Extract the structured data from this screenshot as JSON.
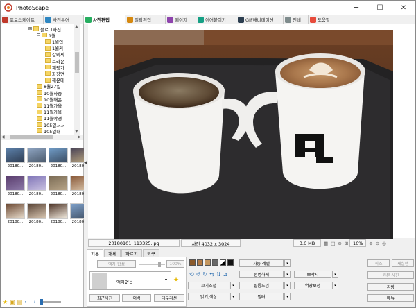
{
  "window": {
    "title": "PhotoScape",
    "minimize": "─",
    "maximize": "☐",
    "close": "✕"
  },
  "tabs": [
    {
      "label": "포토스케이프",
      "color": "#c0392b"
    },
    {
      "label": "사진뷰어",
      "color": "#2e86c1"
    },
    {
      "label": "사진편집",
      "color": "#27ae60"
    },
    {
      "label": "일괄편집",
      "color": "#d68910"
    },
    {
      "label": "페이지",
      "color": "#8e44ad"
    },
    {
      "label": "이어붙이기",
      "color": "#16a085"
    },
    {
      "label": "GIF애니메이션",
      "color": "#2c3e50"
    },
    {
      "label": "인쇄",
      "color": "#7f8c8d"
    },
    {
      "label": "도움말",
      "color": "#e74c3c"
    }
  ],
  "tree": {
    "items": [
      {
        "label": "블로그사진",
        "indent": 0,
        "expander": "⊟"
      },
      {
        "label": "1월",
        "indent": 1,
        "expander": "⊟"
      },
      {
        "label": "1월입",
        "indent": 2,
        "expander": ""
      },
      {
        "label": "1월커",
        "indent": 2,
        "expander": ""
      },
      {
        "label": "갈비찌",
        "indent": 2,
        "expander": ""
      },
      {
        "label": "브라운",
        "indent": 2,
        "expander": ""
      },
      {
        "label": "재평가",
        "indent": 2,
        "expander": ""
      },
      {
        "label": "파장면",
        "indent": 2,
        "expander": ""
      },
      {
        "label": "해운대",
        "indent": 2,
        "expander": ""
      },
      {
        "label": "8월27일",
        "indent": 1,
        "expander": ""
      },
      {
        "label": "10월하중",
        "indent": 1,
        "expander": ""
      },
      {
        "label": "10월해운",
        "indent": 1,
        "expander": ""
      },
      {
        "label": "11월가을",
        "indent": 1,
        "expander": ""
      },
      {
        "label": "11월가을",
        "indent": 1,
        "expander": ""
      },
      {
        "label": "11월야경",
        "indent": 1,
        "expander": ""
      },
      {
        "label": "105일서서",
        "indent": 1,
        "expander": ""
      },
      {
        "label": "105일대",
        "indent": 1,
        "expander": ""
      }
    ]
  },
  "thumbnails": [
    {
      "caption": "20180...",
      "c1": "#5b7fa8",
      "c2": "#2f3d52"
    },
    {
      "caption": "20180...",
      "c1": "#8da3c0",
      "c2": "#4c5b6d"
    },
    {
      "caption": "20180...",
      "c1": "#6f9ac4",
      "c2": "#3b4d63"
    },
    {
      "caption": "20180...",
      "c1": "#4c4658",
      "c2": "#b9a57e"
    },
    {
      "caption": "20180...",
      "c1": "#5a3d6e",
      "c2": "#8d7aa8"
    },
    {
      "caption": "20180...",
      "c1": "#8176b8",
      "c2": "#c9c1e0"
    },
    {
      "caption": "20180...",
      "c1": "#7c6d56",
      "c2": "#b7a488"
    },
    {
      "caption": "20180...",
      "c1": "#8a5a3a",
      "c2": "#d8c3a9"
    },
    {
      "caption": "20180...",
      "c1": "#6d4a34",
      "c2": "#e4d8c8"
    },
    {
      "caption": "20180...",
      "c1": "#5a4436",
      "c2": "#d5c3ae"
    },
    {
      "caption": "20180...",
      "c1": "#4e3528",
      "c2": "#ece4d8"
    },
    {
      "caption": "20180...",
      "c1": "#7ea0c9",
      "c2": "#43546a"
    }
  ],
  "status": {
    "filename": "20180101_113325.jpg",
    "dimensions": "사진 4032 x 3024",
    "filesize": "3.6 MB",
    "zoom": "16%"
  },
  "edit_panel": {
    "tabs": [
      "기본",
      "개체",
      "자르기",
      "도구"
    ],
    "frame_apply": "액자 합성",
    "percent": "100%",
    "frame_name": "액자없음",
    "recent_photos": "최근사진",
    "margin": "여백",
    "frame_line": "테두리선",
    "auto_level": "자동 레벨",
    "sharpen": "선명하게",
    "resize": "크기조절",
    "film_effect": "필름느낌",
    "backlight": "역광보정",
    "brightness": "밝기,색상",
    "filter": "필터",
    "bokeh": "뽀샤시",
    "undo": "취소",
    "redo": "재실행",
    "original": "원본 사진",
    "save": "저장",
    "menu": "메뉴"
  }
}
